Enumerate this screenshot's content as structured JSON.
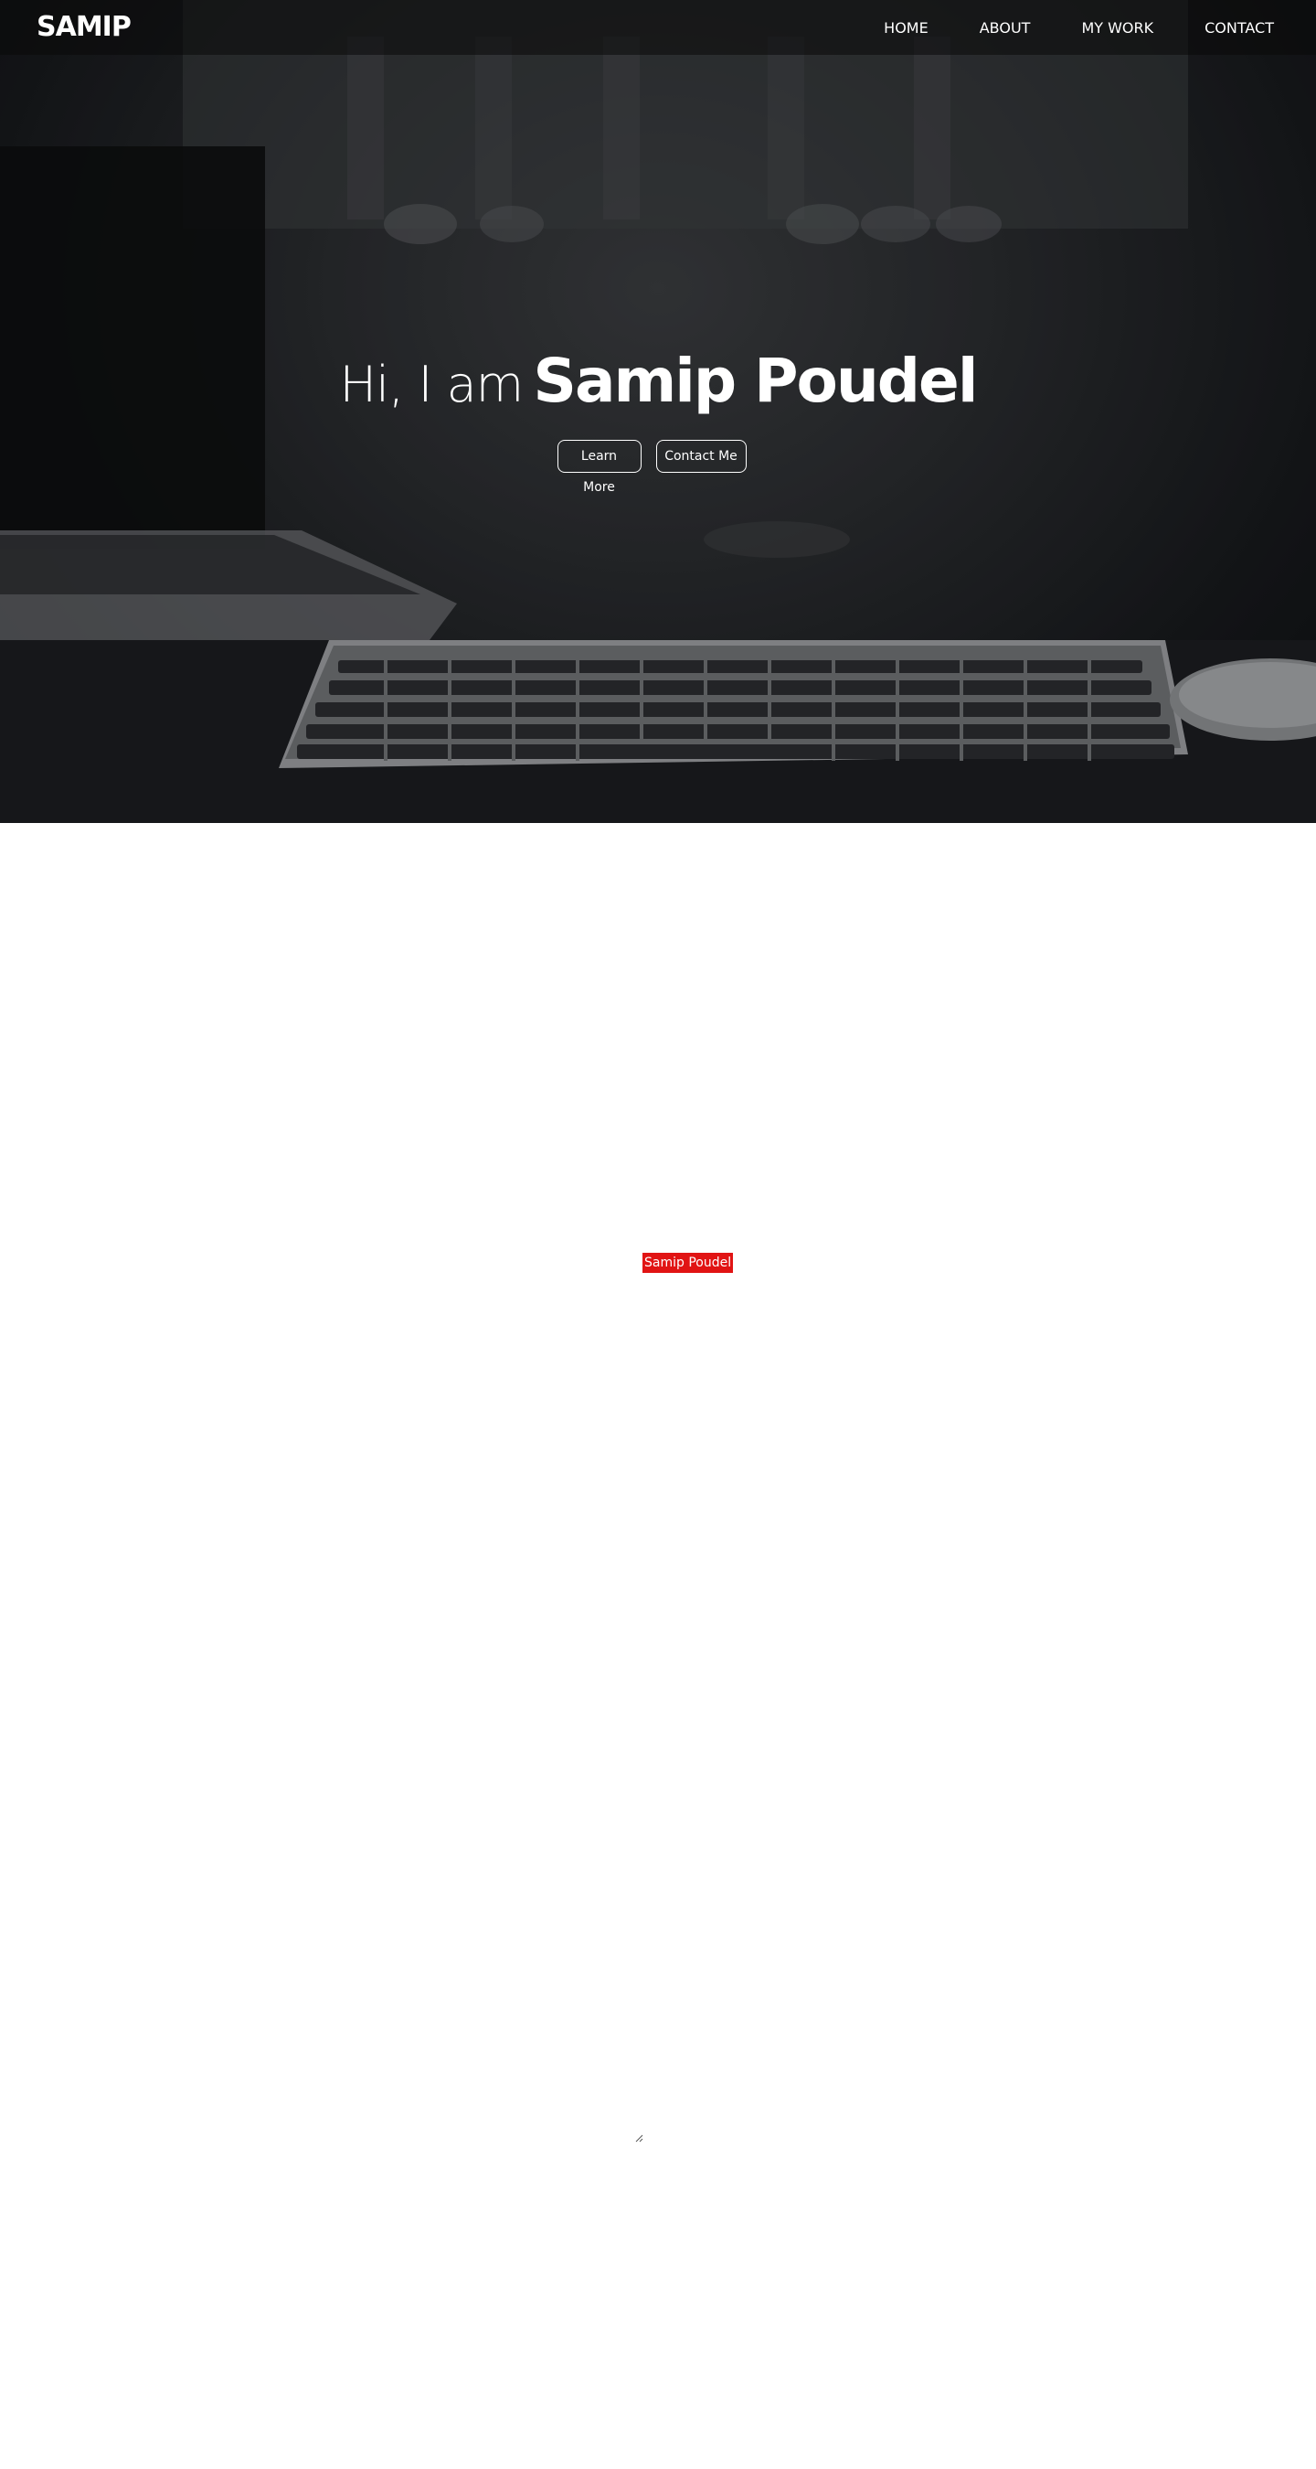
{
  "navbar": {
    "brand": "SAMIP",
    "links": [
      "HOME",
      "ABOUT",
      "MY WORK",
      "CONTACT"
    ]
  },
  "hero": {
    "greeting": "Hi, I am",
    "name": "Samip Poudel",
    "buttons": {
      "learn_more": "Learn More",
      "contact_me": "Contact Me"
    }
  },
  "about": {
    "name_badge": "Samip Poudel"
  },
  "colors": {
    "accent_red": "#e11414",
    "hero_dark": "#16181b",
    "text_light": "#ffffff"
  },
  "icons": {
    "textarea_resize": "resize-handle-icon"
  }
}
